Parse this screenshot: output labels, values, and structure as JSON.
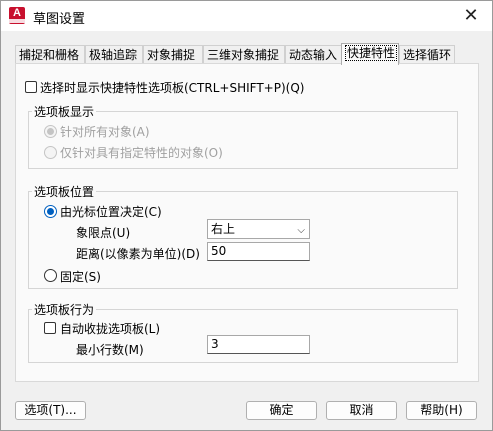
{
  "window": {
    "title": "草图设置",
    "app_icon_letter": "A"
  },
  "tabs": [
    {
      "label": "捕捉和栅格"
    },
    {
      "label": "极轴追踪"
    },
    {
      "label": "对象捕捉"
    },
    {
      "label": "三维对象捕捉"
    },
    {
      "label": "动态输入"
    },
    {
      "label": "快捷特性"
    },
    {
      "label": "选择循环"
    }
  ],
  "active_tab": "快捷特性",
  "quick_props": {
    "show_on_select_label": "选择时显示快捷特性选项板(CTRL+SHIFT+P)(Q)",
    "show_on_select_checked": false
  },
  "palette_display": {
    "title": "选项板显示",
    "all_objects_label": "针对所有对象(A)",
    "specified_objects_label": "仅针对具有指定特性的对象(O)",
    "selected": "all_objects",
    "enabled": false
  },
  "palette_location": {
    "title": "选项板位置",
    "cursor_label": "由光标位置决定(C)",
    "quadrant_label": "象限点(U)",
    "quadrant_value": "右上",
    "distance_label": "距离(以像素为单位)(D)",
    "distance_value": "50",
    "static_label": "固定(S)",
    "selected": "cursor"
  },
  "palette_behavior": {
    "title": "选项板行为",
    "auto_collapse_label": "自动收拢选项板(L)",
    "auto_collapse_checked": false,
    "min_rows_label": "最小行数(M)",
    "min_rows_value": "3"
  },
  "buttons": {
    "options": "选项(T)...",
    "ok": "确定",
    "cancel": "取消",
    "help": "帮助(H)"
  },
  "colors": {
    "accent": "#0060c0",
    "icon_red": "#c8102e"
  }
}
